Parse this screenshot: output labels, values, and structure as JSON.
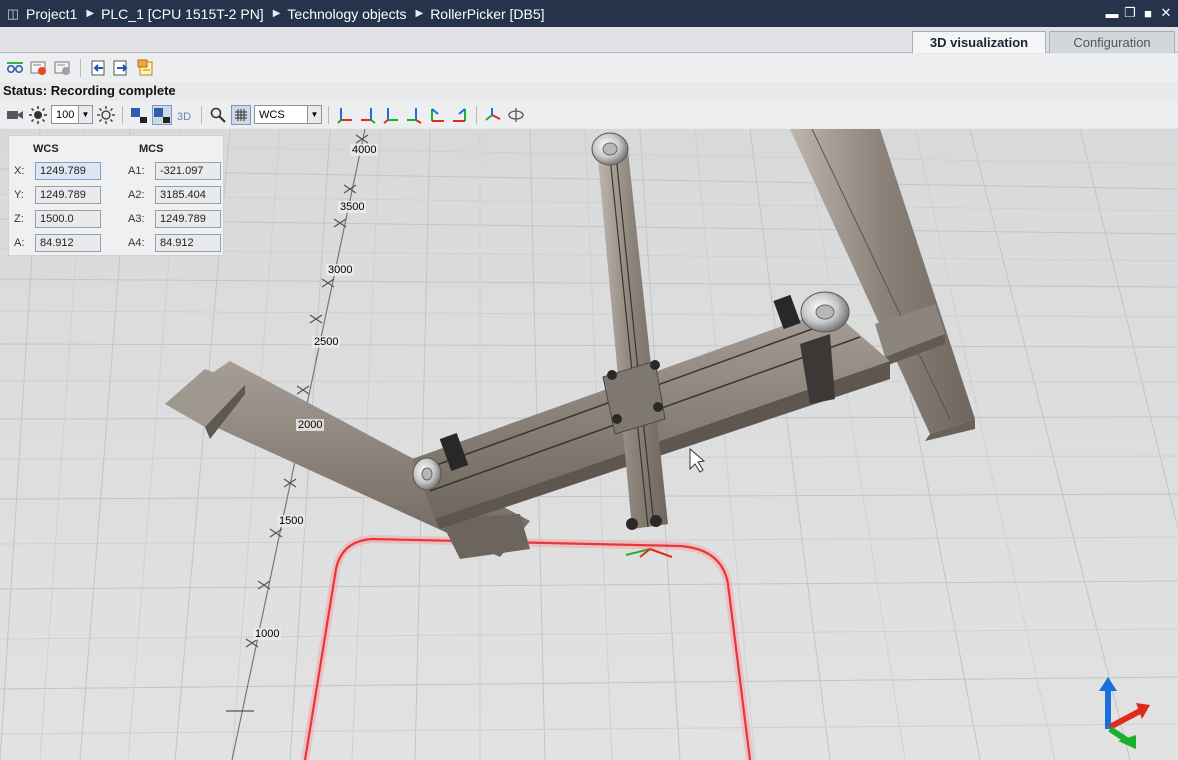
{
  "title_bar": {
    "breadcrumbs": [
      "Project1",
      "PLC_1 [CPU 1515T-2 PN]",
      "Technology objects",
      "RollerPicker [DB5]"
    ]
  },
  "tabs": [
    {
      "label": "3D visualization",
      "active": true
    },
    {
      "label": "Configuration",
      "active": false
    }
  ],
  "status": {
    "label": "Status:",
    "text": "Recording complete"
  },
  "toolbar": {
    "zoom": "100",
    "coord_system": "WCS"
  },
  "coords": {
    "wcs_header": "WCS",
    "mcs_header": "MCS",
    "wcs": [
      {
        "label": "X:",
        "value": "1249.789"
      },
      {
        "label": "Y:",
        "value": "1249.789"
      },
      {
        "label": "Z:",
        "value": "1500.0"
      },
      {
        "label": "A:",
        "value": "84.912"
      }
    ],
    "mcs": [
      {
        "label": "A1:",
        "value": "-321.097"
      },
      {
        "label": "A2:",
        "value": "3185.404"
      },
      {
        "label": "A3:",
        "value": "1249.789"
      },
      {
        "label": "A4:",
        "value": "84.912"
      }
    ]
  },
  "scale_ticks": [
    "4000",
    "3500",
    "3000",
    "2500",
    "2000",
    "1500",
    "1000"
  ],
  "colors": {
    "path": "#e8363a",
    "titlebar": "#26334a",
    "axis_x": "#e02a1f",
    "axis_y": "#1ab02e",
    "axis_z": "#1a6fe0"
  }
}
